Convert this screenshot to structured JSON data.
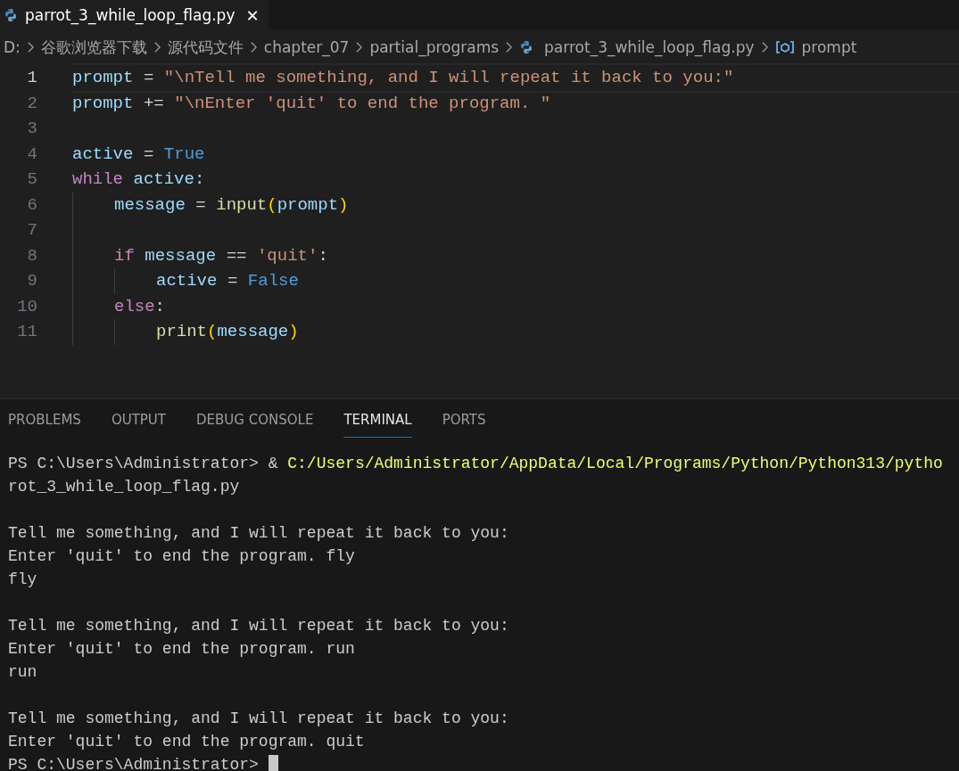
{
  "editor_tab": {
    "title": "parrot_3_while_loop_flag.py",
    "close": "✕"
  },
  "breadcrumbs": [
    {
      "kind": "folder",
      "label": "D:"
    },
    {
      "kind": "folder",
      "label": "谷歌浏览器下载"
    },
    {
      "kind": "folder",
      "label": "源代码文件"
    },
    {
      "kind": "folder",
      "label": "chapter_07"
    },
    {
      "kind": "folder",
      "label": "partial_programs"
    },
    {
      "kind": "file",
      "label": "parrot_3_while_loop_flag.py"
    },
    {
      "kind": "symbol",
      "label": "prompt"
    }
  ],
  "code": [
    {
      "number": "1",
      "current": true,
      "tokens": [
        {
          "kind": "var",
          "text": "prompt"
        },
        {
          "kind": "op",
          "text": "="
        },
        {
          "kind": "str",
          "text": "\"\\nTell me something, and I will repeat it back to you:\""
        }
      ]
    },
    {
      "number": "2",
      "current": false,
      "tokens": [
        {
          "kind": "var",
          "text": "prompt"
        },
        {
          "kind": "op",
          "text": "+="
        },
        {
          "kind": "str",
          "text": "\"\\nEnter 'quit' to end the program. \""
        }
      ]
    },
    {
      "number": "3",
      "current": false
    },
    {
      "number": "4",
      "current": false,
      "tokens": [
        {
          "kind": "var",
          "text": "active"
        },
        {
          "kind": "op",
          "text": "="
        },
        {
          "kind": "const",
          "text": "True"
        }
      ]
    },
    {
      "number": "5",
      "current": false,
      "tokens": [
        {
          "kind": "keyword",
          "text": "while"
        },
        {
          "kind": "var",
          "text": "active:"
        }
      ],
      "children": [
        {
          "number": "6",
          "current": false,
          "tokens": [
            {
              "kind": "var",
              "text": "message"
            },
            {
              "kind": "op",
              "text": "="
            },
            {
              "kind": "call",
              "text": "input(prompt)"
            }
          ]
        },
        {
          "number": "7",
          "current": false
        },
        {
          "number": "8",
          "current": false,
          "tokens": [
            {
              "kind": "keyword",
              "text": "if"
            },
            {
              "kind": "var",
              "text": "message"
            },
            {
              "kind": "op",
              "text": "=="
            },
            {
              "kind": "str",
              "text": "'quit'"
            },
            {
              "kind": "punct",
              "text": ":"
            }
          ],
          "children": [
            {
              "number": "9",
              "current": false,
              "tokens": [
                {
                  "kind": "var",
                  "text": "active"
                },
                {
                  "kind": "op",
                  "text": "="
                },
                {
                  "kind": "const",
                  "text": "False"
                }
              ]
            }
          ]
        },
        {
          "number": "10",
          "current": false,
          "tokens": [
            {
              "kind": "keyword",
              "text": "else"
            },
            {
              "kind": "punct",
              "text": ":"
            }
          ],
          "children": [
            {
              "number": "11",
              "current": false,
              "tokens": [
                {
                  "kind": "call",
                  "text": "print(message)"
                }
              ]
            }
          ]
        }
      ]
    }
  ],
  "panel_tabs": [
    {
      "label": "PROBLEMS",
      "selected": false
    },
    {
      "label": "OUTPUT",
      "selected": false
    },
    {
      "label": "DEBUG CONSOLE",
      "selected": false
    },
    {
      "label": "TERMINAL",
      "selected": true
    },
    {
      "label": "PORTS",
      "selected": false
    }
  ],
  "terminal": [
    {
      "cursor": false,
      "tokens": [
        {
          "kind": "plain",
          "text": "PS C:\\Users\\Administrator>"
        },
        {
          "kind": "plain",
          "text": "&"
        },
        {
          "kind": "path",
          "text": "C:/Users/Administrator/AppData/Local/Programs/Python/Python313/pytho"
        }
      ]
    },
    {
      "cursor": false,
      "tokens": [
        {
          "kind": "plain",
          "text": "rot_3_while_loop_flag.py"
        }
      ]
    },
    {
      "cursor": false
    },
    {
      "cursor": false,
      "tokens": [
        {
          "kind": "plain",
          "text": "Tell me something, and I will repeat it back to you:"
        }
      ]
    },
    {
      "cursor": false,
      "tokens": [
        {
          "kind": "plain",
          "text": "Enter 'quit' to end the program. fly"
        }
      ]
    },
    {
      "cursor": false,
      "tokens": [
        {
          "kind": "plain",
          "text": "fly"
        }
      ]
    },
    {
      "cursor": false
    },
    {
      "cursor": false,
      "tokens": [
        {
          "kind": "plain",
          "text": "Tell me something, and I will repeat it back to you:"
        }
      ]
    },
    {
      "cursor": false,
      "tokens": [
        {
          "kind": "plain",
          "text": "Enter 'quit' to end the program. run"
        }
      ]
    },
    {
      "cursor": false,
      "tokens": [
        {
          "kind": "plain",
          "text": "run"
        }
      ]
    },
    {
      "cursor": false
    },
    {
      "cursor": false,
      "tokens": [
        {
          "kind": "plain",
          "text": "Tell me something, and I will repeat it back to you:"
        }
      ]
    },
    {
      "cursor": false,
      "tokens": [
        {
          "kind": "plain",
          "text": "Enter 'quit' to end the program. quit"
        }
      ]
    },
    {
      "cursor": true,
      "tokens": [
        {
          "kind": "plain",
          "text": "PS C:\\Users\\Administrator>"
        }
      ]
    }
  ]
}
